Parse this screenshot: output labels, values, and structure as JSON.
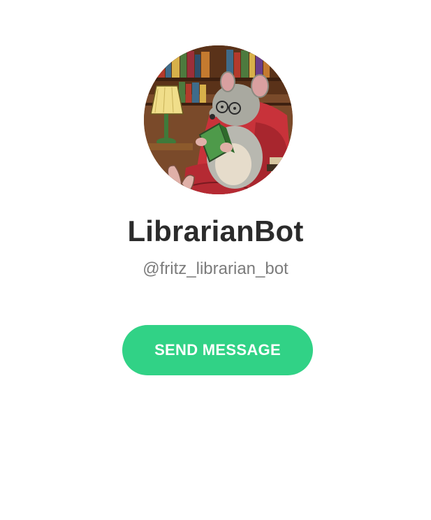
{
  "profile": {
    "avatar_subject": "mouse-reading-book-icon",
    "name": "LibrarianBot",
    "username": "@fritz_librarian_bot",
    "send_button_label": "SEND MESSAGE"
  },
  "colors": {
    "page_background": "#ffffff",
    "name_text": "#2b2b2b",
    "username_text": "#7c7c7c",
    "button_background": "#31d286",
    "button_text": "#ffffff"
  }
}
